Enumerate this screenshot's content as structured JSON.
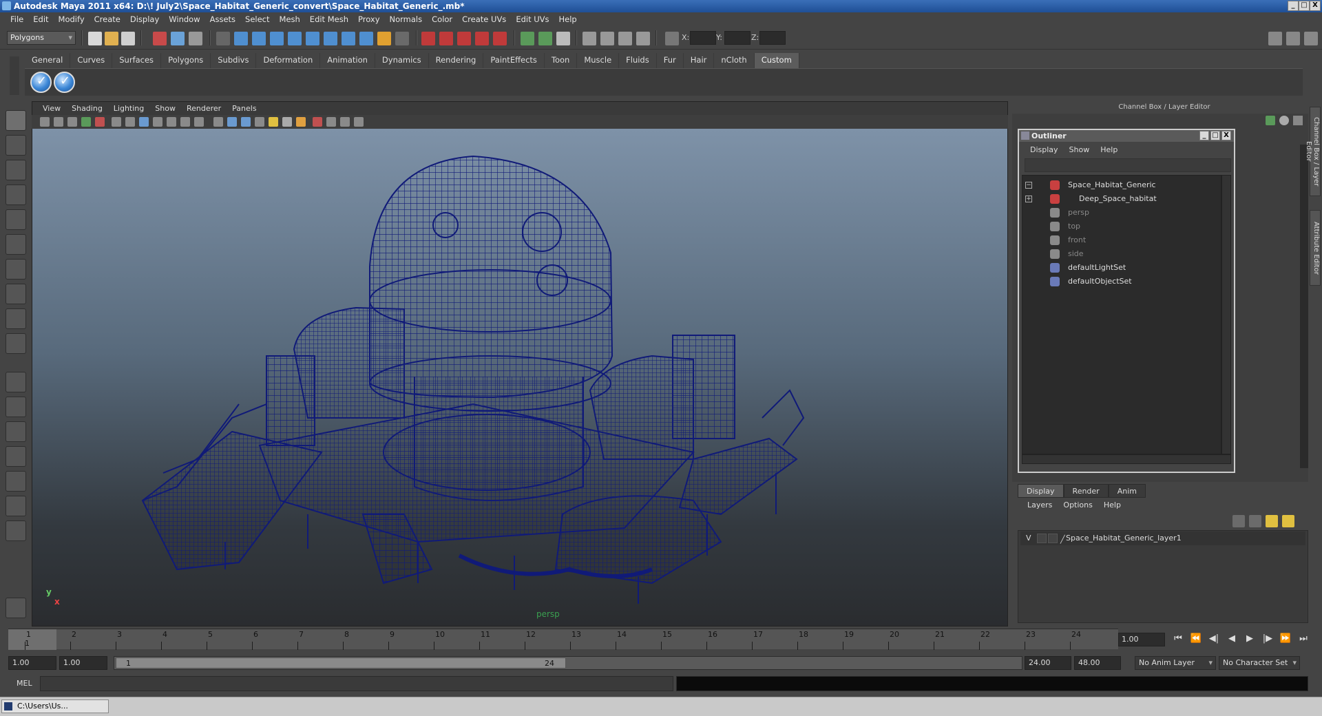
{
  "window": {
    "title": "Autodesk Maya 2011 x64: D:\\! July2\\Space_Habitat_Generic_convert\\Space_Habitat_Generic_.mb*",
    "min_btn": "_",
    "max_btn": "□",
    "close_btn": "X"
  },
  "menubar": [
    "File",
    "Edit",
    "Modify",
    "Create",
    "Display",
    "Window",
    "Assets",
    "Select",
    "Mesh",
    "Edit Mesh",
    "Proxy",
    "Normals",
    "Color",
    "Create UVs",
    "Edit UVs",
    "Help"
  ],
  "statusline": {
    "mode": "Polygons",
    "x_label": "X:",
    "y_label": "Y:",
    "z_label": "Z:"
  },
  "shelf": {
    "tabs": [
      "General",
      "Curves",
      "Surfaces",
      "Polygons",
      "Subdivs",
      "Deformation",
      "Animation",
      "Dynamics",
      "Rendering",
      "PaintEffects",
      "Toon",
      "Muscle",
      "Fluids",
      "Fur",
      "Hair",
      "nCloth",
      "Custom"
    ],
    "active_tab": "Custom",
    "buttons": [
      "check-icon",
      "check-icon"
    ]
  },
  "viewport": {
    "menu": [
      "View",
      "Shading",
      "Lighting",
      "Show",
      "Renderer",
      "Panels"
    ],
    "camera_label": "persp",
    "axis_y": "y",
    "axis_x": "x",
    "wire_color": "#101a78"
  },
  "channel_box": {
    "header": "Channel Box / Layer Editor",
    "side_tabs": [
      "Channel Box / Layer Editor",
      "Attribute Editor"
    ]
  },
  "outliner": {
    "title": "Outliner",
    "menu": [
      "Display",
      "Show",
      "Help"
    ],
    "items": [
      {
        "label": "Space_Habitat_Generic",
        "icon": "mesh-icon",
        "expander": "−",
        "dim": false
      },
      {
        "label": "Deep_Space_habitat",
        "icon": "mesh-icon",
        "expander": "+",
        "dim": false
      },
      {
        "label": "persp",
        "icon": "camera-icon",
        "dim": true
      },
      {
        "label": "top",
        "icon": "camera-icon",
        "dim": true
      },
      {
        "label": "front",
        "icon": "camera-icon",
        "dim": true
      },
      {
        "label": "side",
        "icon": "camera-icon",
        "dim": true
      },
      {
        "label": "defaultLightSet",
        "icon": "set-icon",
        "dim": false
      },
      {
        "label": "defaultObjectSet",
        "icon": "set-icon",
        "dim": false
      }
    ]
  },
  "layer_editor": {
    "tabs": [
      "Display",
      "Render",
      "Anim"
    ],
    "active_tab": "Display",
    "menu": [
      "Layers",
      "Options",
      "Help"
    ],
    "layer": {
      "visible": "V",
      "name": "Space_Habitat_Generic_layer1"
    }
  },
  "timeline": {
    "frames": [
      "1",
      "2",
      "3",
      "4",
      "5",
      "6",
      "7",
      "8",
      "9",
      "10",
      "11",
      "12",
      "13",
      "14",
      "15",
      "16",
      "17",
      "18",
      "19",
      "20",
      "21",
      "22",
      "23",
      "24"
    ],
    "current_frame": "1",
    "current_time": "1.00",
    "playback": [
      "⏮",
      "⏪",
      "◀|",
      "◀",
      "▶",
      "|▶",
      "⏩",
      "⏭"
    ]
  },
  "range": {
    "start": "1.00",
    "playback_start": "1.00",
    "range_start_label": "1",
    "range_end_label": "24",
    "playback_end": "24.00",
    "end": "48.00",
    "anim_layer": "No Anim Layer",
    "character_set": "No Character Set"
  },
  "command_line": {
    "label": "MEL"
  },
  "taskbar": {
    "item": "C:\\Users\\Us..."
  }
}
